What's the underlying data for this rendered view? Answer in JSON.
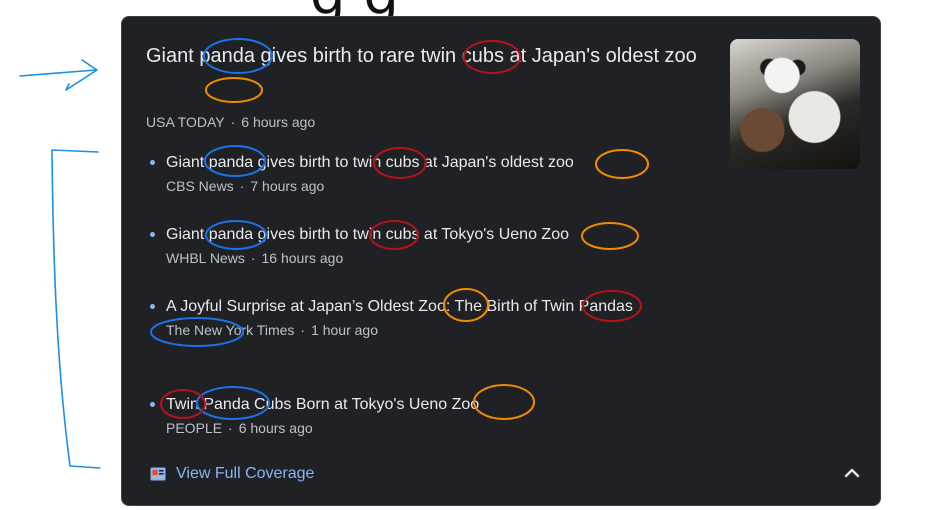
{
  "page_top_text": "g      g",
  "card": {
    "headline": "Giant panda gives birth to rare twin cubs at Japan's oldest zoo",
    "source": "USA TODAY",
    "time": "6 hours ago",
    "thumbnail": "panda-photo",
    "stories": [
      {
        "title": "Giant panda gives birth to twin cubs at Japan's oldest zoo",
        "source": "CBS News",
        "time": "7 hours ago"
      },
      {
        "title": "Giant panda gives birth to twin cubs at Tokyo's Ueno Zoo",
        "source": "WHBL News",
        "time": "16 hours ago"
      },
      {
        "title": "A Joyful Surprise at Japan’s Oldest Zoo: The Birth of Twin Pandas",
        "source": "The New York Times",
        "time": "1 hour ago"
      },
      {
        "title": "Twin Panda Cubs Born at Tokyo's Ueno Zoo",
        "source": "PEOPLE",
        "time": "6 hours ago"
      }
    ],
    "coverage_label": "View Full Coverage",
    "coverage_icon": "newspaper-icon",
    "collapse_icon": "chevron-up-icon"
  },
  "annotations": {
    "arrow_color": "#1a8fe3",
    "bracket_color": "#1a8fe3",
    "circle_colors": {
      "panda": "#1a73e8",
      "twin": "#b3141c",
      "zoo": "#f08c00"
    }
  },
  "colors": {
    "card_bg": "#202124",
    "text": "#e8eaed",
    "secondary": "#bdc1c6",
    "accent": "#8ab4f8"
  }
}
